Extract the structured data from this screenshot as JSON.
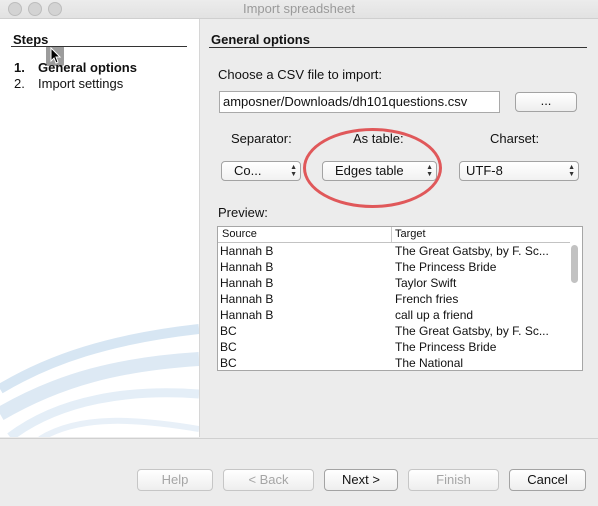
{
  "window": {
    "title": "Import spreadsheet"
  },
  "steps": {
    "title": "Steps",
    "items": [
      {
        "num": "1.",
        "label": "General options"
      },
      {
        "num": "2.",
        "label": "Import settings"
      }
    ]
  },
  "main": {
    "title": "General options",
    "file_label": "Choose a CSV file to import:",
    "file_path": "amposner/Downloads/dh101questions.csv",
    "browse_label": "...",
    "separator_label": "Separator:",
    "separator_value": "Co...",
    "as_table_label": "As table:",
    "as_table_value": "Edges table",
    "charset_label": "Charset:",
    "charset_value": "UTF-8",
    "preview_label": "Preview:"
  },
  "preview": {
    "columns": [
      "Source",
      "Target"
    ],
    "rows": [
      [
        "Hannah B",
        "The Great Gatsby, by F. Sc..."
      ],
      [
        "Hannah B",
        "The Princess Bride"
      ],
      [
        "Hannah B",
        "Taylor Swift"
      ],
      [
        "Hannah B",
        "French fries"
      ],
      [
        "Hannah B",
        "call up a friend"
      ],
      [
        "BC",
        "The Great Gatsby, by F. Sc..."
      ],
      [
        "BC",
        "The Princess Bride"
      ],
      [
        "BC",
        "The National"
      ]
    ]
  },
  "footer": {
    "help": "Help",
    "back": "< Back",
    "next": "Next >",
    "finish": "Finish",
    "cancel": "Cancel"
  },
  "colors": {
    "annotation_circle": "#e0585a"
  }
}
